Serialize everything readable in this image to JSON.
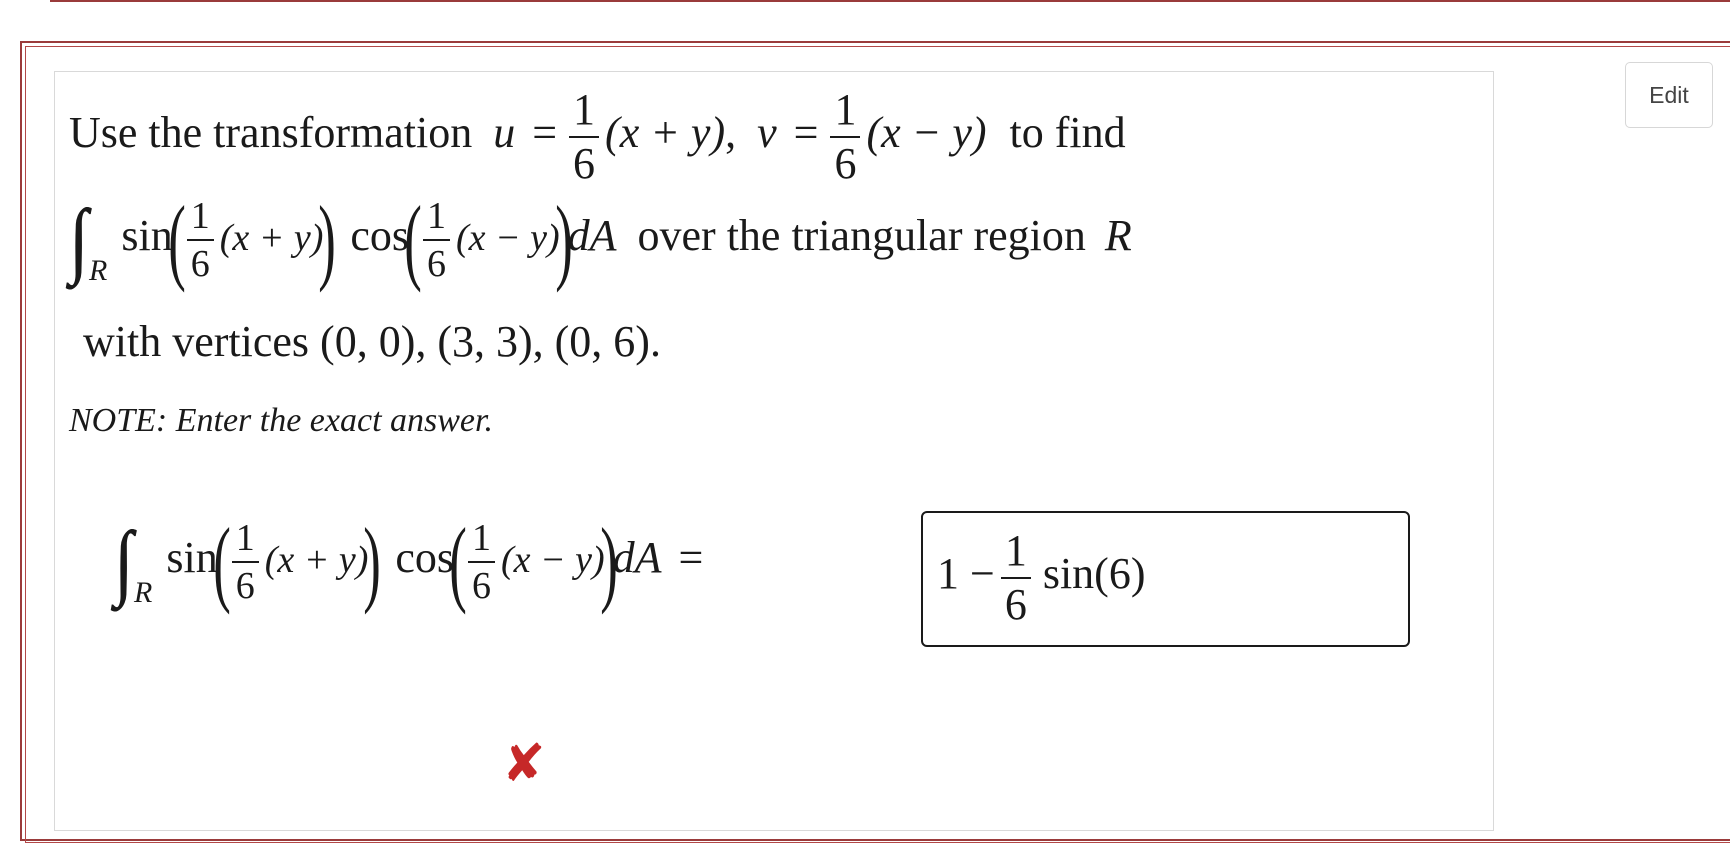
{
  "toolbar": {
    "edit_label": "Edit"
  },
  "question": {
    "line1_intro": "Use the transformation",
    "u_var": "u",
    "v_var": "v",
    "equals": "=",
    "frac_num": "1",
    "frac_den": "6",
    "expr_plus": "(x + y)",
    "expr_minus": "(x − y)",
    "sep": ",",
    "line1_end": "to find",
    "integral_sub": "R",
    "sin_fn": "sin",
    "cos_fn": "cos",
    "dA": "dA",
    "line2_end": "over the triangular region",
    "region_var": "R",
    "line3": "with vertices (0, 0),  (3, 3),  (0, 6).",
    "note": "NOTE: Enter the exact answer."
  },
  "answer": {
    "prefix": "1 −",
    "frac_num": "1",
    "frac_den": "6",
    "suffix": "sin(6)"
  },
  "status": {
    "incorrect_icon": "✘",
    "color": "#c62828"
  }
}
